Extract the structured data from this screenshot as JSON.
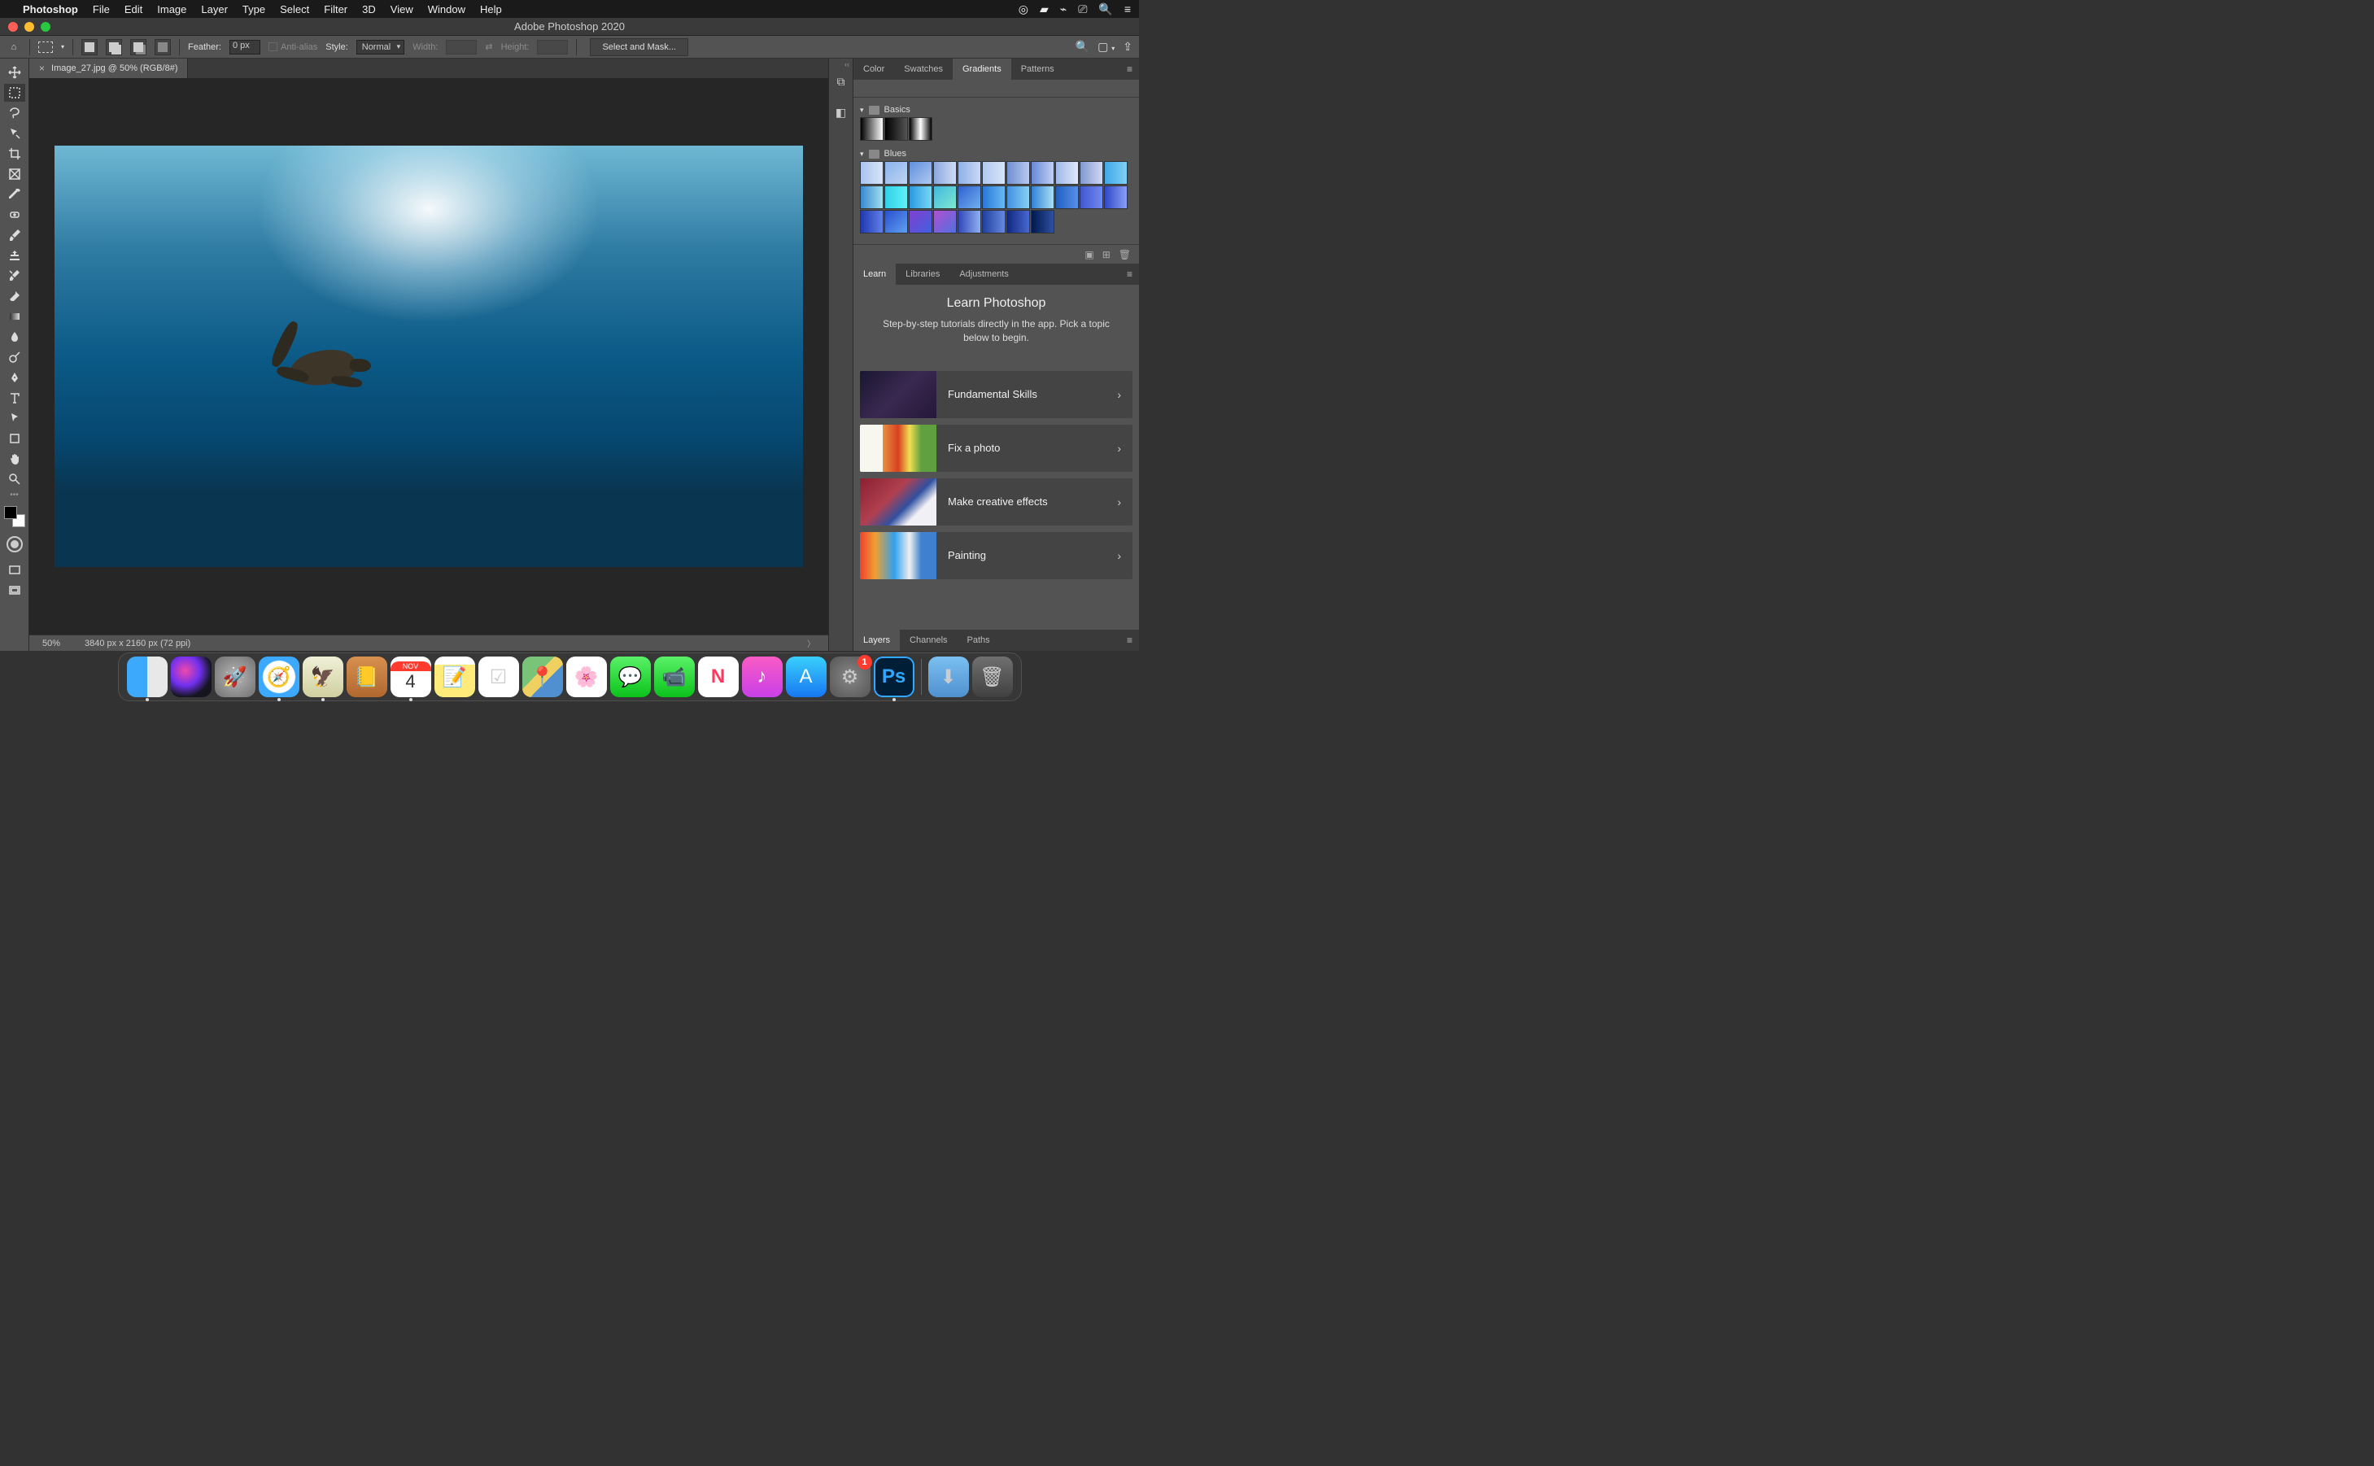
{
  "menubar": {
    "app": "Photoshop",
    "items": [
      "File",
      "Edit",
      "Image",
      "Layer",
      "Type",
      "Select",
      "Filter",
      "3D",
      "View",
      "Window",
      "Help"
    ]
  },
  "window": {
    "title": "Adobe Photoshop 2020"
  },
  "options": {
    "feather_label": "Feather:",
    "feather_value": "0 px",
    "antialias_label": "Anti-alias",
    "style_label": "Style:",
    "style_value": "Normal",
    "width_label": "Width:",
    "height_label": "Height:",
    "mask_button": "Select and Mask..."
  },
  "document": {
    "tab_title": "Image_27.jpg @ 50% (RGB/8#)",
    "zoom": "50%",
    "dimensions": "3840 px x 2160 px (72 ppi)"
  },
  "tools": [
    {
      "name": "move-tool"
    },
    {
      "name": "marquee-tool",
      "active": true
    },
    {
      "name": "lasso-tool"
    },
    {
      "name": "quick-select-tool"
    },
    {
      "name": "crop-tool"
    },
    {
      "name": "frame-tool"
    },
    {
      "name": "eyedropper-tool"
    },
    {
      "name": "healing-brush-tool"
    },
    {
      "name": "brush-tool"
    },
    {
      "name": "clone-stamp-tool"
    },
    {
      "name": "history-brush-tool"
    },
    {
      "name": "eraser-tool"
    },
    {
      "name": "gradient-tool"
    },
    {
      "name": "blur-tool"
    },
    {
      "name": "dodge-tool"
    },
    {
      "name": "pen-tool"
    },
    {
      "name": "type-tool"
    },
    {
      "name": "path-select-tool"
    },
    {
      "name": "shape-tool"
    },
    {
      "name": "hand-tool"
    },
    {
      "name": "zoom-tool"
    }
  ],
  "panels": {
    "top_tabs": [
      "Color",
      "Swatches",
      "Gradients",
      "Patterns"
    ],
    "top_active": "Gradients",
    "gradients": {
      "groups": [
        {
          "name": "Basics",
          "swatches": [
            "linear-gradient(90deg,#000,#fff)",
            "linear-gradient(90deg,#000,transparent)",
            "linear-gradient(90deg,#000,#fff,#000)"
          ]
        },
        {
          "name": "Blues",
          "swatches": [
            "linear-gradient(90deg,#a8c4f0,#d8e4f8)",
            "linear-gradient(135deg,#8ab4f0,#c0d4f0)",
            "linear-gradient(135deg,#6090e0,#b0c8f0)",
            "linear-gradient(90deg,#88a8e0,#d0dcf4)",
            "linear-gradient(90deg,#90b0e8,#c8d8f4)",
            "linear-gradient(90deg,#b0c8f0,#d8e4f8)",
            "linear-gradient(90deg,#7090d0,#b8c8f0)",
            "linear-gradient(90deg,#6888d8,#c0d0f4)",
            "linear-gradient(90deg,#a0b8e8,#e0e8f8)",
            "linear-gradient(90deg,#8098d0,#d0d8f4)",
            "linear-gradient(90deg,#40a8e8,#80d0f4)",
            "linear-gradient(90deg,#3888d0,#a0e0f0)",
            "linear-gradient(90deg,#30d0e8,#60f0f8)",
            "linear-gradient(90deg,#2898e0,#78d8f4)",
            "linear-gradient(135deg,#40b8e0,#80e8d0)",
            "linear-gradient(135deg,#3060d0,#70b0f0)",
            "linear-gradient(90deg,#2878d8,#68b8f4)",
            "linear-gradient(90deg,#4090e0,#88d0f4)",
            "linear-gradient(90deg,#3080d8,#a8e0f4)",
            "linear-gradient(90deg,#2060c0,#5890e8)",
            "linear-gradient(90deg,#4058d0,#7088f0)",
            "linear-gradient(90deg,#3048c8,#88a0f4)",
            "linear-gradient(90deg,#2038b0,#6080e8)",
            "linear-gradient(135deg,#2850d0,#60a0f0)",
            "linear-gradient(135deg,#8040d0,#4060e0)",
            "linear-gradient(135deg,#b050d0,#5070e0)",
            "linear-gradient(90deg,#3048b8,#90b0f0)",
            "linear-gradient(90deg,#2040a0,#6888e0)",
            "linear-gradient(90deg,#102880,#4868d0)",
            "linear-gradient(90deg,#001850,#3050a0)"
          ]
        }
      ]
    },
    "mid_tabs": [
      "Learn",
      "Libraries",
      "Adjustments"
    ],
    "mid_active": "Learn",
    "learn": {
      "title": "Learn Photoshop",
      "subtitle": "Step-by-step tutorials directly in the app. Pick a topic below to begin.",
      "items": [
        {
          "label": "Fundamental Skills",
          "thumb": "th1"
        },
        {
          "label": "Fix a photo",
          "thumb": "th2"
        },
        {
          "label": "Make creative effects",
          "thumb": "th3"
        },
        {
          "label": "Painting",
          "thumb": "th4"
        }
      ]
    },
    "bottom_tabs": [
      "Layers",
      "Channels",
      "Paths"
    ],
    "bottom_active": "Layers"
  },
  "dock": {
    "calendar": {
      "month": "NOV",
      "day": "4"
    },
    "ps_badge": "1",
    "apps": [
      {
        "name": "finder",
        "cls": "di-finder",
        "active": true
      },
      {
        "name": "siri",
        "cls": "di-siri"
      },
      {
        "name": "launchpad",
        "cls": "di-launch",
        "glyph": "🚀"
      },
      {
        "name": "safari",
        "cls": "di-safari",
        "glyph": "🧭",
        "active": true
      },
      {
        "name": "mail",
        "cls": "di-mail",
        "glyph": "🦅",
        "active": true
      },
      {
        "name": "contacts",
        "cls": "di-contacts",
        "glyph": "📒"
      },
      {
        "name": "calendar",
        "cls": "di-cal",
        "calendar": true,
        "active": true
      },
      {
        "name": "notes",
        "cls": "di-notes",
        "glyph": "📝"
      },
      {
        "name": "reminders",
        "cls": "di-reminders",
        "glyph": "☑"
      },
      {
        "name": "maps",
        "cls": "di-maps",
        "glyph": "📍"
      },
      {
        "name": "photos",
        "cls": "di-photos",
        "glyph": "🌸"
      },
      {
        "name": "messages",
        "cls": "di-msg",
        "glyph": "💬"
      },
      {
        "name": "facetime",
        "cls": "di-ft",
        "glyph": "📹"
      },
      {
        "name": "news",
        "cls": "di-news",
        "glyph": "N"
      },
      {
        "name": "music",
        "cls": "di-music",
        "glyph": "♪"
      },
      {
        "name": "appstore",
        "cls": "di-store",
        "glyph": "A"
      },
      {
        "name": "system-preferences",
        "cls": "di-prefs",
        "glyph": "⚙",
        "badge": "1"
      },
      {
        "name": "photoshop",
        "cls": "di-ps",
        "glyph": "Ps",
        "active": true
      }
    ]
  }
}
